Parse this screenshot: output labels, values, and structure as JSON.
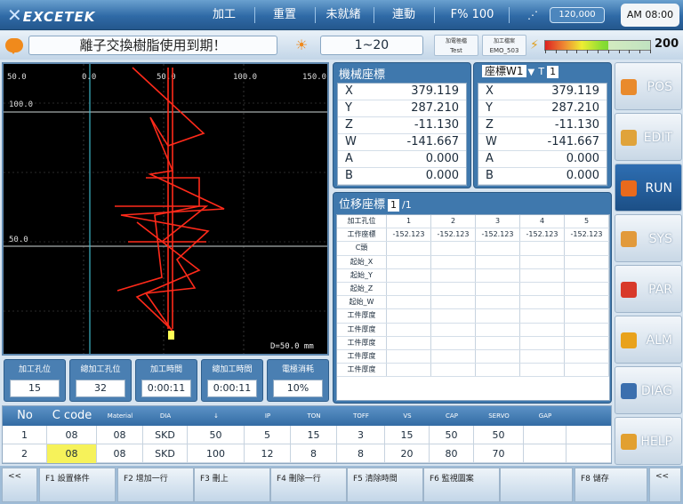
{
  "topbar": {
    "logo": "EXCETEK",
    "menu": [
      "加工",
      "重置",
      "未就緒",
      "連動"
    ],
    "feed_label": "F% 100",
    "speed": "120,000",
    "clock": "AM 08:00"
  },
  "message": {
    "text": "離子交換樹脂使用到期！",
    "range": "1~20",
    "info1": [
      "加電極檔",
      "Test"
    ],
    "info2": [
      "加工檔案",
      "EMO_503"
    ],
    "power_value": "200",
    "power_level": 0.6
  },
  "plot": {
    "axis_top": [
      "50.0",
      "0.0",
      "50.0",
      "100.0",
      "150.0"
    ],
    "axis_left": [
      "50.0",
      "100.0",
      "50.0"
    ],
    "scale_label": "D=50.0 mm"
  },
  "stats": [
    {
      "label": "加工孔位",
      "value": "15"
    },
    {
      "label": "總加工孔位",
      "value": "32"
    },
    {
      "label": "加工時間",
      "value": "0:00:11"
    },
    {
      "label": "總加工時間",
      "value": "0:00:11"
    },
    {
      "label": "電極消耗",
      "value": "10%"
    }
  ],
  "mech": {
    "title": "機械座標",
    "rows": [
      {
        "axis": "X",
        "value": "379.119"
      },
      {
        "axis": "Y",
        "value": "287.210"
      },
      {
        "axis": "Z",
        "value": "-11.130"
      },
      {
        "axis": "W",
        "value": "-141.667"
      },
      {
        "axis": "A",
        "value": "0.000"
      },
      {
        "axis": "B",
        "value": "0.000"
      }
    ]
  },
  "work": {
    "title": "座標W1",
    "t_label": "T",
    "t_value": "1",
    "rows": [
      {
        "axis": "X",
        "value": "379.119"
      },
      {
        "axis": "Y",
        "value": "287.210"
      },
      {
        "axis": "Z",
        "value": "-11.130"
      },
      {
        "axis": "W",
        "value": "-141.667"
      },
      {
        "axis": "A",
        "value": "0.000"
      },
      {
        "axis": "B",
        "value": "0.000"
      }
    ]
  },
  "offset": {
    "title": "位移座標",
    "page": "1",
    "total": "/1",
    "headers": [
      "加工孔位",
      "1",
      "2",
      "3",
      "4",
      "5"
    ],
    "rows": [
      [
        "工作座標",
        "-152.123",
        "-152.123",
        "-152.123",
        "-152.123",
        "-152.123"
      ],
      [
        "C頭",
        "",
        "",
        "",
        "",
        ""
      ],
      [
        "起始_X",
        "",
        "",
        "",
        "",
        ""
      ],
      [
        "起始_Y",
        "",
        "",
        "",
        "",
        ""
      ],
      [
        "起始_Z",
        "",
        "",
        "",
        "",
        ""
      ],
      [
        "起始_W",
        "",
        "",
        "",
        "",
        ""
      ],
      [
        "工件厚度",
        "",
        "",
        "",
        "",
        ""
      ],
      [
        "工件厚度",
        "",
        "",
        "",
        "",
        ""
      ],
      [
        "工件厚度",
        "",
        "",
        "",
        "",
        ""
      ],
      [
        "工件厚度",
        "",
        "",
        "",
        "",
        ""
      ],
      [
        "工件厚度",
        "",
        "",
        "",
        "",
        ""
      ]
    ]
  },
  "nav": [
    {
      "label": "POS",
      "icon": "position-icon",
      "color": "#e98a2c"
    },
    {
      "label": "EDIT",
      "icon": "edit-icon",
      "color": "#e0a33a"
    },
    {
      "label": "RUN",
      "icon": "run-icon",
      "color": "#e96a1c"
    },
    {
      "label": "SYS",
      "icon": "system-icon",
      "color": "#e29a3b"
    },
    {
      "label": "PAR",
      "icon": "parameter-icon",
      "color": "#d8392a"
    },
    {
      "label": "ALM",
      "icon": "alarm-icon",
      "color": "#e9a21c"
    },
    {
      "label": "DIAG",
      "icon": "diagnostic-icon",
      "color": "#3b6fae"
    },
    {
      "label": "HELP",
      "icon": "help-icon",
      "color": "#e2a030"
    }
  ],
  "active_nav": "RUN",
  "table": {
    "headers": [
      "No",
      "C code",
      "Material",
      "DIA",
      "↓",
      "IP",
      "TON",
      "TOFF",
      "VS",
      "CAP",
      "SERVO",
      "GAP"
    ],
    "rows": [
      [
        "1",
        "08",
        "08",
        "SKD",
        "50",
        "5",
        "15",
        "3",
        "15",
        "50",
        "50",
        ""
      ],
      [
        "2",
        "08",
        "08",
        "SKD",
        "100",
        "12",
        "8",
        "8",
        "20",
        "80",
        "70",
        ""
      ]
    ]
  },
  "fkeys": [
    "<<",
    "F1 設置條件",
    "F2 增加一行",
    "F3 刪上",
    "F4 刪除一行",
    "F5 清除時間",
    "F6 監視圖案",
    "",
    "F8 儲存",
    "<<"
  ]
}
